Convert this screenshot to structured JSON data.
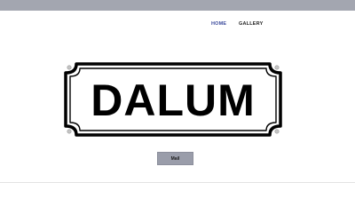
{
  "nav": {
    "home_label": "HOME",
    "gallery_label": "GALLERY"
  },
  "sign": {
    "text": "DALUM"
  },
  "mail_button": {
    "label": "Mail"
  },
  "colors": {
    "top_bar": "#a3a6b0",
    "nav_active": "#3b4a9c",
    "button_bg": "#9a9daa"
  }
}
